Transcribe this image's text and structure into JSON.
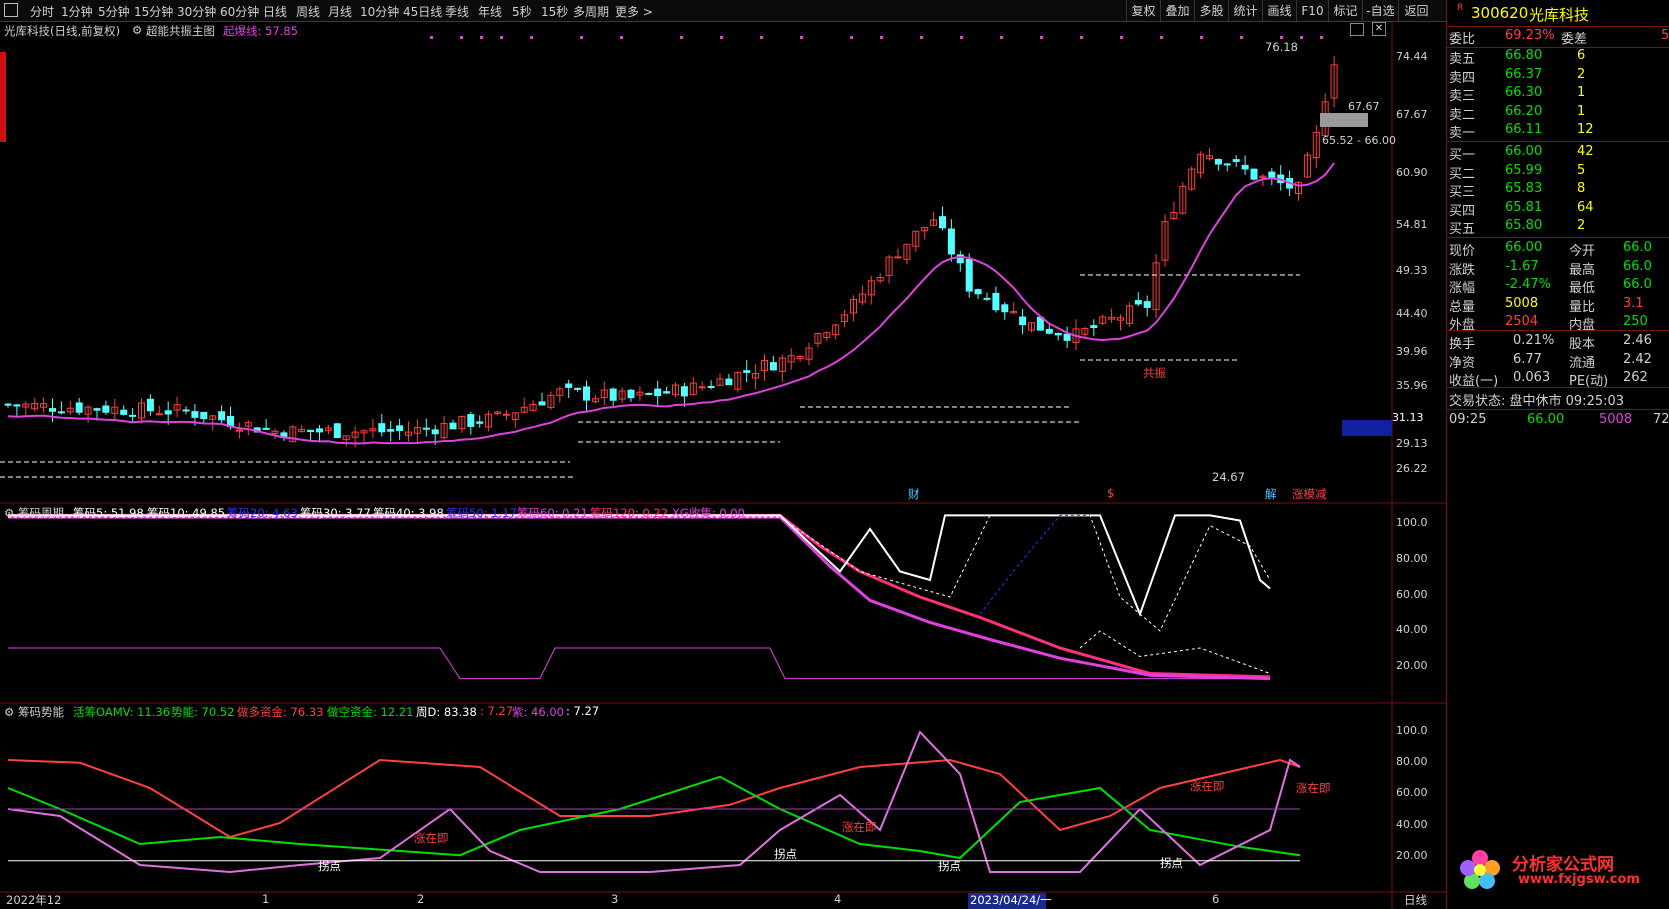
{
  "toolbar": {
    "icon": "window-icon",
    "periods": [
      "分时",
      "1分钟",
      "5分钟",
      "15分钟",
      "30分钟",
      "60分钟",
      "日线",
      "周线",
      "月线",
      "10分钟",
      "45日线",
      "季线",
      "年线",
      "5秒",
      "15秒",
      "多周期",
      "更多 >"
    ],
    "right": [
      "复权",
      "叠加",
      "多股",
      "统计",
      "画线",
      "F10",
      "标记",
      "-自选",
      "返回"
    ]
  },
  "main_chart": {
    "title": "光库科技(日线,前复权)",
    "indicator_name": "超能共振主图",
    "line_label": "起爆线: 57.85",
    "axis": [
      "74.44",
      "67.67",
      "60.90",
      "54.81",
      "49.33",
      "44.40",
      "39.96",
      "35.96",
      "29.13",
      "26.22"
    ],
    "current_price_tag": "31.13",
    "high_label": "76.18",
    "low_label": "24.67",
    "price_tag_1": "67.67",
    "price_tag_2": "65.52 - 66.00",
    "gongzhen_label": "共振",
    "event_markers": [
      "财",
      "$",
      "解",
      "涨模减"
    ]
  },
  "chip_panel": {
    "title": "筹码周期",
    "legend": [
      "筹码5: 51.98",
      "筹码10: 49.85",
      "筹码20: 4.63",
      "筹码30: 3.77",
      "筹码40: 3.98",
      "筹码50: 1.17",
      "筹码60: 0.21",
      "筹码120: 0.22",
      "XG收集: 0.00"
    ],
    "axis": [
      "100.0",
      "80.00",
      "60.00",
      "40.00",
      "20.00"
    ]
  },
  "energy_panel": {
    "title": "筹码势能",
    "legend": [
      "活筹OAMV: 11.36",
      "势能: 70.52",
      "做多资金: 76.33",
      "做空资金: 12.21",
      "周D: 83.38",
      ": 7.27",
      "紫: 46.00",
      ": 7.27"
    ],
    "axis": [
      "100.0",
      "80.00",
      "60.00",
      "40.00",
      "20.00"
    ],
    "annotations": [
      "涨在即",
      "涨在即",
      "涨在即",
      "涨在即",
      "拐点",
      "拐点",
      "拐点",
      "拐点"
    ]
  },
  "x_axis": {
    "labels": [
      "2022年12",
      "1",
      "2",
      "3",
      "4",
      "6"
    ],
    "date_box": "2023/04/24/一",
    "period": "日线"
  },
  "quote": {
    "code": "300620",
    "name": "光库科技",
    "r_tag": "R",
    "webi_label": "委比",
    "webi_value": "69.23%",
    "weicha_label": "委差",
    "weicha_value": "5",
    "sell": [
      {
        "label": "卖五",
        "price": "66.80",
        "vol": "6"
      },
      {
        "label": "卖四",
        "price": "66.37",
        "vol": "2"
      },
      {
        "label": "卖三",
        "price": "66.30",
        "vol": "1"
      },
      {
        "label": "卖二",
        "price": "66.20",
        "vol": "1"
      },
      {
        "label": "卖一",
        "price": "66.11",
        "vol": "12"
      }
    ],
    "buy": [
      {
        "label": "买一",
        "price": "66.00",
        "vol": "42"
      },
      {
        "label": "买二",
        "price": "65.99",
        "vol": "5"
      },
      {
        "label": "买三",
        "price": "65.83",
        "vol": "8"
      },
      {
        "label": "买四",
        "price": "65.81",
        "vol": "64"
      },
      {
        "label": "买五",
        "price": "65.80",
        "vol": "2"
      }
    ],
    "stats": [
      {
        "l1": "现价",
        "v1": "66.00",
        "l2": "今开",
        "v2": "66.0"
      },
      {
        "l1": "涨跌",
        "v1": "-1.67",
        "l2": "最高",
        "v2": "66.0"
      },
      {
        "l1": "涨幅",
        "v1": "-2.47%",
        "l2": "最低",
        "v2": "66.0"
      },
      {
        "l1": "总量",
        "v1": "5008",
        "l2": "量比",
        "v2": "3.1"
      },
      {
        "l1": "外盘",
        "v1": "2504",
        "l2": "内盘",
        "v2": "250"
      }
    ],
    "fin": [
      {
        "l1": "换手",
        "v1": "0.21%",
        "l2": "股本",
        "v2": "2.46"
      },
      {
        "l1": "净资",
        "v1": "6.77",
        "l2": "流通",
        "v2": "2.42"
      },
      {
        "l1": "收益(一)",
        "v1": "0.063",
        "l2": "PE(动)",
        "v2": "262"
      }
    ],
    "status": "交易状态: 盘中休市 09:25:03",
    "tick": {
      "time": "09:25",
      "price": "66.00",
      "vol": "5008",
      "extra": "72"
    }
  },
  "watermark": {
    "brand": "分析家公式网",
    "url": "www.fxjgsw.com"
  },
  "colors": {
    "up": "#ff3c3c",
    "down": "#54ffff",
    "ma": "#e040e0",
    "rise": "#ff4040",
    "fall": "#00e000",
    "accent": "#ffff00"
  }
}
